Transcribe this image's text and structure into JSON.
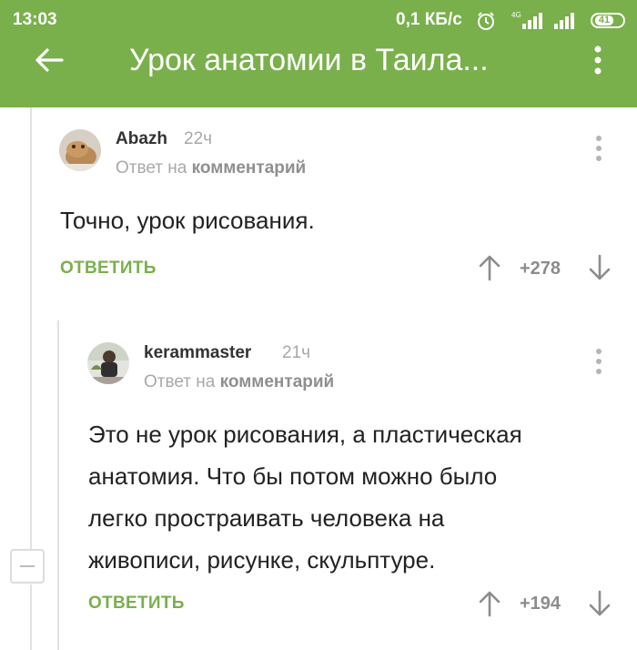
{
  "status_bar": {
    "time": "13:03",
    "speed": "0,1 КБ/с",
    "network": "4G",
    "battery": "41"
  },
  "app_bar": {
    "title": "Урок анатомии в Таила...",
    "back_icon": "arrow-left-icon",
    "menu_icon": "more-vertical-icon",
    "background_color": "#79b04b"
  },
  "comments": [
    {
      "username": "Abazh",
      "time": "22ч",
      "reply_prefix": "Ответ на",
      "reply_target": "комментарий",
      "text": "Точно, урок рисования.",
      "reply_label": "ОТВЕТИТЬ",
      "rating": "+278"
    },
    {
      "username": "kerammaster",
      "time": "21ч",
      "reply_prefix": "Ответ на",
      "reply_target": "комментарий",
      "text_lines": [
        "Это не урок рисования, а пластическая",
        "анатомия. Что бы потом можно было",
        "легко простраивать человека на",
        "живописи, рисунке, скульптуре."
      ],
      "reply_label": "ОТВЕТИТЬ",
      "rating": "+194"
    }
  ],
  "colors": {
    "accent": "#79b04b",
    "muted_text": "#a8a8a8",
    "thread_line": "#e1e1e1"
  }
}
